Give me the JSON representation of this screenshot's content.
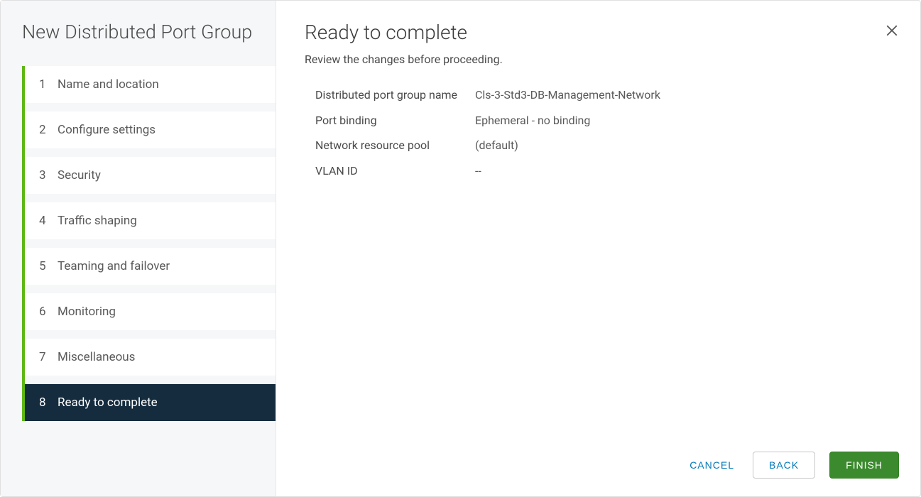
{
  "sidebar": {
    "title": "New Distributed Port Group",
    "steps": [
      {
        "number": "1",
        "label": "Name and location"
      },
      {
        "number": "2",
        "label": "Configure settings"
      },
      {
        "number": "3",
        "label": "Security"
      },
      {
        "number": "4",
        "label": "Traffic shaping"
      },
      {
        "number": "5",
        "label": "Teaming and failover"
      },
      {
        "number": "6",
        "label": "Monitoring"
      },
      {
        "number": "7",
        "label": "Miscellaneous"
      },
      {
        "number": "8",
        "label": "Ready to complete"
      }
    ]
  },
  "main": {
    "title": "Ready to complete",
    "subtitle": "Review the changes before proceeding.",
    "details": [
      {
        "label": "Distributed port group name",
        "value": "Cls-3-Std3-DB-Management-Network"
      },
      {
        "label": "Port binding",
        "value": "Ephemeral - no binding"
      },
      {
        "label": "Network resource pool",
        "value": "(default)"
      },
      {
        "label": "VLAN ID",
        "value": "--"
      }
    ]
  },
  "footer": {
    "cancel": "CANCEL",
    "back": "BACK",
    "finish": "FINISH"
  }
}
